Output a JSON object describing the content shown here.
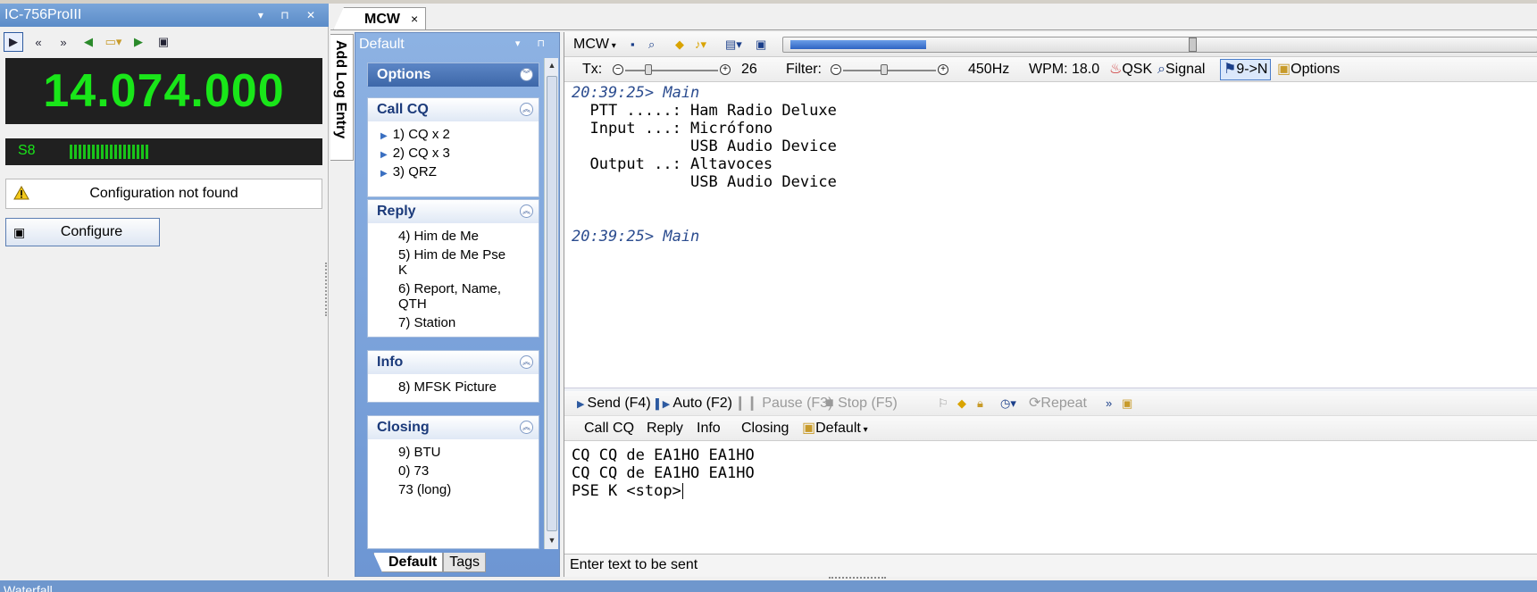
{
  "radio_panel": {
    "title": "IC-756ProIII",
    "frequency": "14.074.000",
    "smeter_label": "S8",
    "smeter_bars": 18,
    "warning": "Configuration not found",
    "configure_label": "Configure"
  },
  "side_tab": {
    "label": "Add Log Entry"
  },
  "doc_tab": {
    "label": "MCW",
    "close": "×"
  },
  "macro_panel": {
    "title": "Default",
    "options_header": "Options",
    "sections": [
      {
        "title": "Call CQ",
        "items": [
          "1)  CQ x 2",
          "2)  CQ x 3",
          "3)  QRZ"
        ]
      },
      {
        "title": "Reply",
        "items": [
          "4)  Him de Me",
          "5)  Him de Me Pse",
          "K",
          "6)  Report, Name,",
          "QTH",
          "7)  Station"
        ]
      },
      {
        "title": "Info",
        "items": [
          "8)  MFSK Picture"
        ]
      },
      {
        "title": "Closing",
        "items": [
          "9)  BTU",
          "0)  73",
          "73 (long)"
        ]
      }
    ],
    "tabs": [
      "Default",
      "Tags"
    ]
  },
  "toolbar": {
    "mode": "MCW",
    "progress_fraction": 0.18,
    "tx_label": "Tx:",
    "tx_value": "26",
    "filter_label": "Filter:",
    "filter_value": "450Hz",
    "wpm": "WPM:  18.0",
    "qsk": "QSK",
    "signal": "Signal",
    "nine_to_n": "9->N",
    "options": "Options"
  },
  "log": {
    "lines": [
      {
        "ts": "20:39:25> Main",
        "text": ""
      },
      {
        "ts": "",
        "text": "  PTT .....: Ham Radio Deluxe"
      },
      {
        "ts": "",
        "text": "  Input ...: Micrófono"
      },
      {
        "ts": "",
        "text": "             USB Audio Device"
      },
      {
        "ts": "",
        "text": "  Output ..: Altavoces"
      },
      {
        "ts": "",
        "text": "             USB Audio Device"
      },
      {
        "ts": "20:39:25> Main",
        "text": ""
      }
    ]
  },
  "send_toolbar": {
    "send": "Send  (F4)",
    "auto": "Auto  (F2)",
    "pause": "Pause  (F3)",
    "stop": "Stop  (F5)",
    "repeat": "Repeat"
  },
  "macro_toolbar": {
    "items": [
      "Call CQ",
      "Reply",
      "Info",
      "Closing"
    ],
    "default": "Default"
  },
  "send_text": [
    "CQ CQ de EA1HO EA1HO",
    "CQ CQ de EA1HO EA1HO",
    "PSE K <stop>"
  ],
  "status_text": "Enter text to be sent",
  "bottom_bar": "Waterfall",
  "colors": {
    "freq_green": "#19e619",
    "title_blue": "#5b8cc8"
  }
}
